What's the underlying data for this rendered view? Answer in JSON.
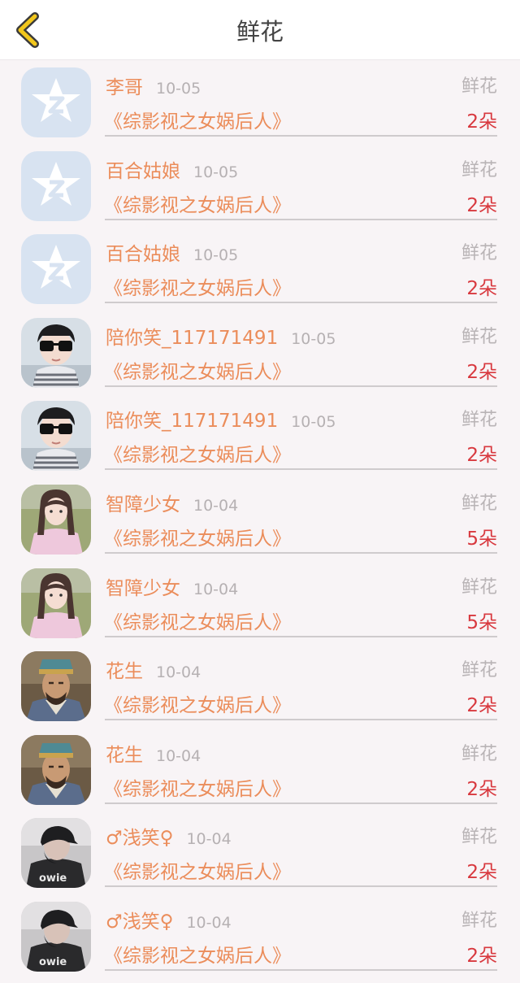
{
  "header": {
    "title": "鲜花",
    "back_icon": "chevron-left-icon",
    "back_color": "#f2c71c"
  },
  "colors": {
    "name": "#eb8d5b",
    "date": "#b6b1b3",
    "type": "#b9b4b6",
    "count": "#d8393f"
  },
  "records": [
    {
      "avatar": "qq-star",
      "name": "李哥",
      "date": "10-05",
      "type": "鲜花",
      "book": "《综影视之女娲后人》",
      "count": "2朵"
    },
    {
      "avatar": "qq-star",
      "name": "百合姑娘",
      "date": "10-05",
      "type": "鲜花",
      "book": "《综影视之女娲后人》",
      "count": "2朵"
    },
    {
      "avatar": "qq-star",
      "name": "百合姑娘",
      "date": "10-05",
      "type": "鲜花",
      "book": "《综影视之女娲后人》",
      "count": "2朵"
    },
    {
      "avatar": "boy-glasses",
      "name": "陪你笑_117171491",
      "date": "10-05",
      "type": "鲜花",
      "book": "《综影视之女娲后人》",
      "count": "2朵"
    },
    {
      "avatar": "boy-glasses",
      "name": "陪你笑_117171491",
      "date": "10-05",
      "type": "鲜花",
      "book": "《综影视之女娲后人》",
      "count": "2朵"
    },
    {
      "avatar": "girl-pink",
      "name": "智障少女",
      "date": "10-04",
      "type": "鲜花",
      "book": "《综影视之女娲后人》",
      "count": "5朵"
    },
    {
      "avatar": "girl-pink",
      "name": "智障少女",
      "date": "10-04",
      "type": "鲜花",
      "book": "《综影视之女娲后人》",
      "count": "5朵"
    },
    {
      "avatar": "strategist",
      "name": "花生",
      "date": "10-04",
      "type": "鲜花",
      "book": "《综影视之女娲后人》",
      "count": "2朵"
    },
    {
      "avatar": "strategist",
      "name": "花生",
      "date": "10-04",
      "type": "鲜花",
      "book": "《综影视之女娲后人》",
      "count": "2朵"
    },
    {
      "avatar": "cap-person",
      "name": "♂浅笑♀",
      "date": "10-04",
      "type": "鲜花",
      "book": "《综影视之女娲后人》",
      "count": "2朵"
    },
    {
      "avatar": "cap-person",
      "name": "♂浅笑♀",
      "date": "10-04",
      "type": "鲜花",
      "book": "《综影视之女娲后人》",
      "count": "2朵"
    }
  ]
}
